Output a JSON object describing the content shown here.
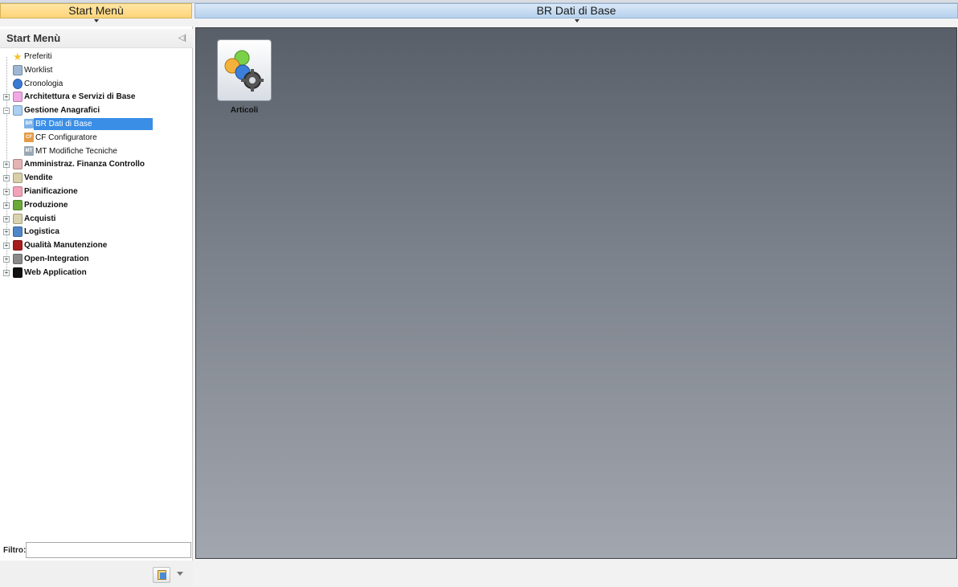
{
  "left_header": {
    "title": "Start Menù"
  },
  "right_header": {
    "title": "BR Dati di Base"
  },
  "sidebar": {
    "title": "Start Menù",
    "items": [
      {
        "label": "Preferiti",
        "icon": "star-icon",
        "color": "#f6c234",
        "level": 0,
        "bold": false,
        "expander": "none"
      },
      {
        "label": "Worklist",
        "icon": "worklist-icon",
        "color": "#9db7d4",
        "level": 0,
        "bold": false,
        "expander": "none"
      },
      {
        "label": "Cronologia",
        "icon": "history-icon",
        "color": "#3a7bd5",
        "level": 0,
        "bold": false,
        "expander": "none"
      },
      {
        "label": "Architettura e Servizi di Base",
        "icon": "folder-icon",
        "color": "#f1a9e6",
        "level": 0,
        "bold": true,
        "expander": "plus"
      },
      {
        "label": "Gestione Anagrafici",
        "icon": "folder-icon",
        "color": "#a9d0f2",
        "level": 0,
        "bold": true,
        "expander": "minus"
      },
      {
        "label": "BR Dati di Base",
        "badge": "BR",
        "color": "#7fb3e6",
        "level": 1,
        "bold": false,
        "selected": true
      },
      {
        "label": "CF Configuratore",
        "badge": "CF",
        "color": "#e59a45",
        "level": 1,
        "bold": false
      },
      {
        "label": "MT Modifiche Tecniche",
        "badge": "MT",
        "color": "#9aa8b6",
        "level": 1,
        "bold": false
      },
      {
        "label": "Amministraz. Finanza Controllo",
        "icon": "folder-icon",
        "color": "#e5b3b3",
        "level": 0,
        "bold": true,
        "expander": "plus"
      },
      {
        "label": "Vendite",
        "icon": "folder-icon",
        "color": "#d9cfa8",
        "level": 0,
        "bold": true,
        "expander": "plus"
      },
      {
        "label": "Pianificazione",
        "icon": "folder-icon",
        "color": "#f3a3b8",
        "level": 0,
        "bold": true,
        "expander": "plus"
      },
      {
        "label": "Produzione",
        "icon": "folder-icon",
        "color": "#6aa83a",
        "level": 0,
        "bold": true,
        "expander": "plus"
      },
      {
        "label": "Acquisti",
        "icon": "folder-icon",
        "color": "#d8d2ae",
        "level": 0,
        "bold": true,
        "expander": "plus"
      },
      {
        "label": "Logistica",
        "icon": "folder-icon",
        "color": "#4f86c9",
        "level": 0,
        "bold": true,
        "expander": "plus"
      },
      {
        "label": "Qualità Manutenzione",
        "icon": "folder-icon",
        "color": "#a81c1c",
        "level": 0,
        "bold": true,
        "expander": "plus"
      },
      {
        "label": "Open-Integration",
        "icon": "folder-icon",
        "color": "#8a8a8a",
        "level": 0,
        "bold": true,
        "expander": "plus"
      },
      {
        "label": "Web Application",
        "icon": "folder-icon",
        "color": "#111111",
        "level": 0,
        "bold": true,
        "expander": "plus"
      }
    ]
  },
  "filter": {
    "label": "Filtro:",
    "value": ""
  },
  "main": {
    "tiles": [
      {
        "label": "Articoli",
        "icon": "articles-icon"
      }
    ]
  }
}
